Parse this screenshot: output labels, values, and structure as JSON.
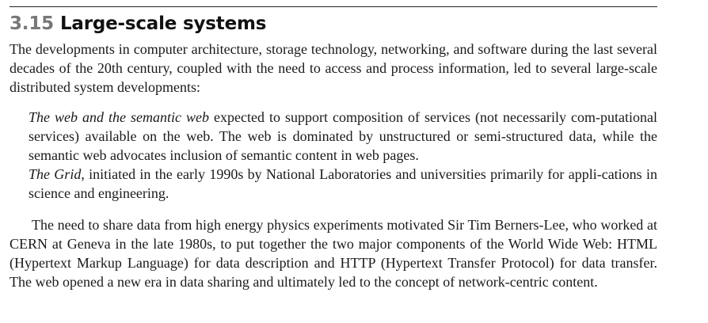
{
  "section": {
    "number": "3.15",
    "title": "Large-scale systems"
  },
  "intro": "The developments in computer architecture, storage technology, networking, and software during the last several decades of the 20th century, coupled with the need to access and process information, led to several large-scale distributed system developments:",
  "items": [
    {
      "term": "The web and the semantic web",
      "text": " expected to support composition of services (not necessarily com-putational services) available on the web. The web is dominated by unstructured or semi-structured data, while the semantic web advocates inclusion of semantic content in web pages."
    },
    {
      "term": "The Grid",
      "text": ", initiated in the early 1990s by National Laboratories and universities primarily for appli-cations in science and engineering."
    }
  ],
  "closing": "The need to share data from high energy physics experiments motivated Sir Tim Berners-Lee, who worked at CERN at Geneva in the late 1980s, to put together the two major components of the World Wide Web: HTML (Hypertext Markup Language) for data description and HTTP (Hypertext Transfer Protocol) for data transfer. The web opened a new era in data sharing and ultimately led to the concept of network-centric content."
}
